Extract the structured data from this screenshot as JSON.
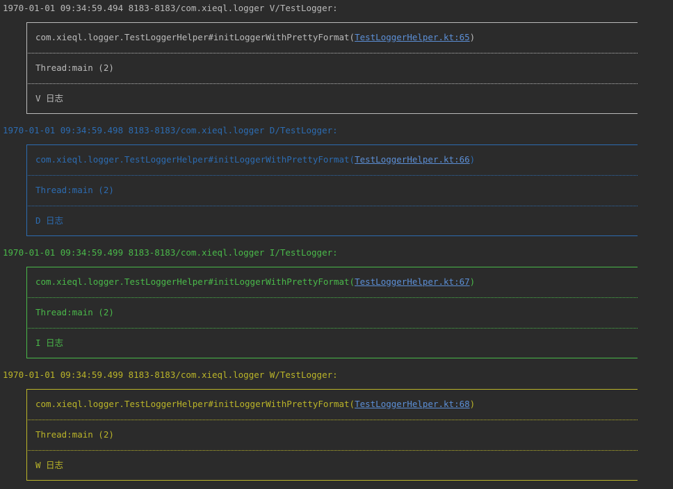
{
  "colors": {
    "background": "#2b2b2b",
    "verbose": "#bbbbbb",
    "debug": "#2c6cb2",
    "info": "#4ab94a",
    "warn": "#bbb529",
    "link": "#5c8fd6"
  },
  "logs": [
    {
      "level": "V",
      "header": "1970-01-01 09:34:59.494 8183-8183/com.xieql.logger V/TestLogger:",
      "method_prefix": "com.xieql.logger.TestLoggerHelper#initLoggerWithPrettyFormat(",
      "link": "TestLoggerHelper.kt:65",
      "method_suffix": ")",
      "thread": "Thread:main (2)",
      "message": "V 日志"
    },
    {
      "level": "D",
      "header": "1970-01-01 09:34:59.498 8183-8183/com.xieql.logger D/TestLogger:",
      "method_prefix": "com.xieql.logger.TestLoggerHelper#initLoggerWithPrettyFormat(",
      "link": "TestLoggerHelper.kt:66",
      "method_suffix": ")",
      "thread": "Thread:main (2)",
      "message": "D 日志"
    },
    {
      "level": "I",
      "header": "1970-01-01 09:34:59.499 8183-8183/com.xieql.logger I/TestLogger:",
      "method_prefix": "com.xieql.logger.TestLoggerHelper#initLoggerWithPrettyFormat(",
      "link": "TestLoggerHelper.kt:67",
      "method_suffix": ")",
      "thread": "Thread:main (2)",
      "message": "I 日志"
    },
    {
      "level": "W",
      "header": "1970-01-01 09:34:59.499 8183-8183/com.xieql.logger W/TestLogger:",
      "method_prefix": "com.xieql.logger.TestLoggerHelper#initLoggerWithPrettyFormat(",
      "link": "TestLoggerHelper.kt:68",
      "method_suffix": ")",
      "thread": "Thread:main (2)",
      "message": "W 日志"
    }
  ]
}
